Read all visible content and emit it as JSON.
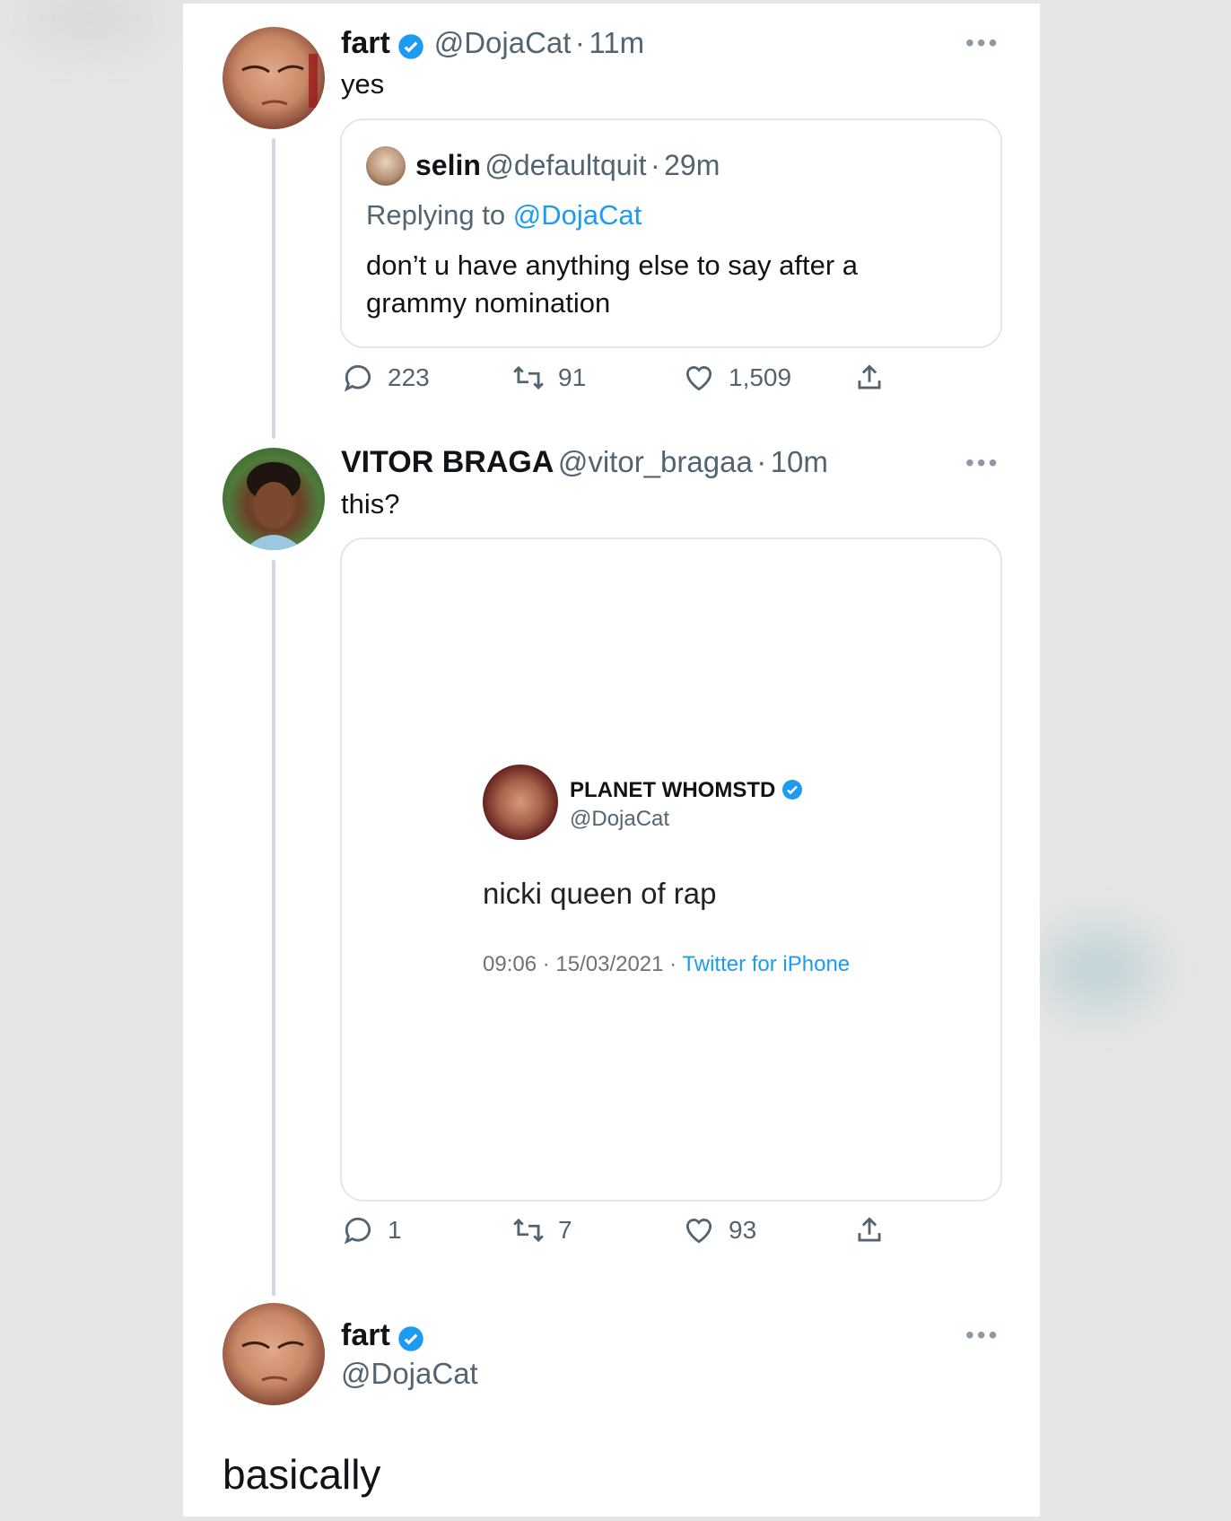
{
  "tweets": [
    {
      "display_name": "fart",
      "handle": "@DojaCat",
      "time": "11m",
      "text": "yes",
      "quoted": {
        "display_name": "selin",
        "handle": "@defaultquit",
        "time": "29m",
        "replying_label": "Replying to",
        "replying_handle": "@DojaCat",
        "text_line1": "don’t u have anything else to say after a",
        "text_line2": "grammy nomination"
      },
      "stats": {
        "replies": "223",
        "retweets": "91",
        "likes": "1,509"
      }
    },
    {
      "display_name": "VITOR BRAGA",
      "handle": "@vitor_bragaa",
      "time": "10m",
      "text": "this?",
      "embedded_screenshot": {
        "display_name": "PLANET WHOMSTD",
        "handle": "@DojaCat",
        "text": "nicki queen of rap",
        "datetime": "09:06 · 15/03/2021 ·",
        "source": "Twitter for iPhone"
      },
      "stats": {
        "replies": "1",
        "retweets": "7",
        "likes": "93"
      }
    },
    {
      "display_name": "fart",
      "handle": "@DojaCat",
      "text": "basically"
    }
  ],
  "separator": "·",
  "more_label": "•••",
  "colors": {
    "accent": "#1d9bf0",
    "secondary_text": "#536471",
    "thread_line": "#cfd9de"
  },
  "icons": [
    "verified-badge-icon",
    "reply-icon",
    "retweet-icon",
    "like-icon",
    "share-icon",
    "more-icon"
  ]
}
